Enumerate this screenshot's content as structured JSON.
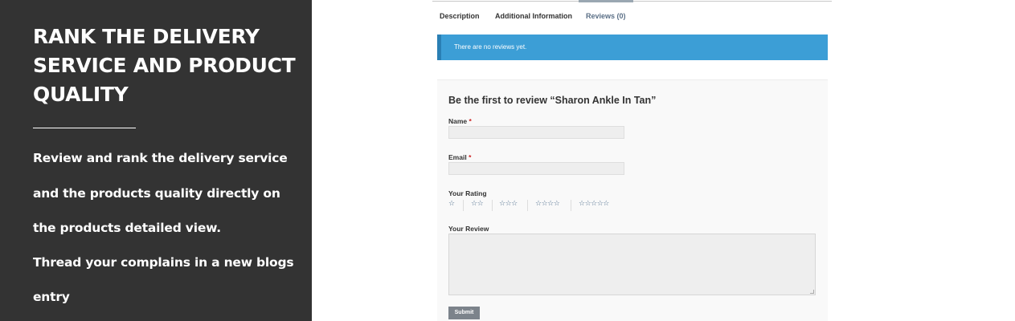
{
  "left": {
    "title": "RANK THE DELIVERY\nSERVICE AND PRODUCT\nQUALITY",
    "lines": [
      "Review and rank the delivery service",
      "and the products quality directly on",
      "the products detailed view.",
      "Thread your complains in a new blogs",
      "entry"
    ]
  },
  "tabs": [
    {
      "label": "Description",
      "active": false
    },
    {
      "label": "Additional Information",
      "active": false
    },
    {
      "label": "Reviews (0)",
      "active": true
    }
  ],
  "notice": "There are no reviews yet.",
  "form": {
    "title": "Be the first to review “Sharon Ankle In Tan”",
    "name_label": "Name",
    "email_label": "Email",
    "required_mark": "*",
    "rating_label": "Your Rating",
    "rating_options": [
      "☆",
      "☆☆",
      "☆☆☆",
      "☆☆☆☆",
      "☆☆☆☆☆"
    ],
    "review_label": "Your Review",
    "submit_label": "Submit"
  }
}
